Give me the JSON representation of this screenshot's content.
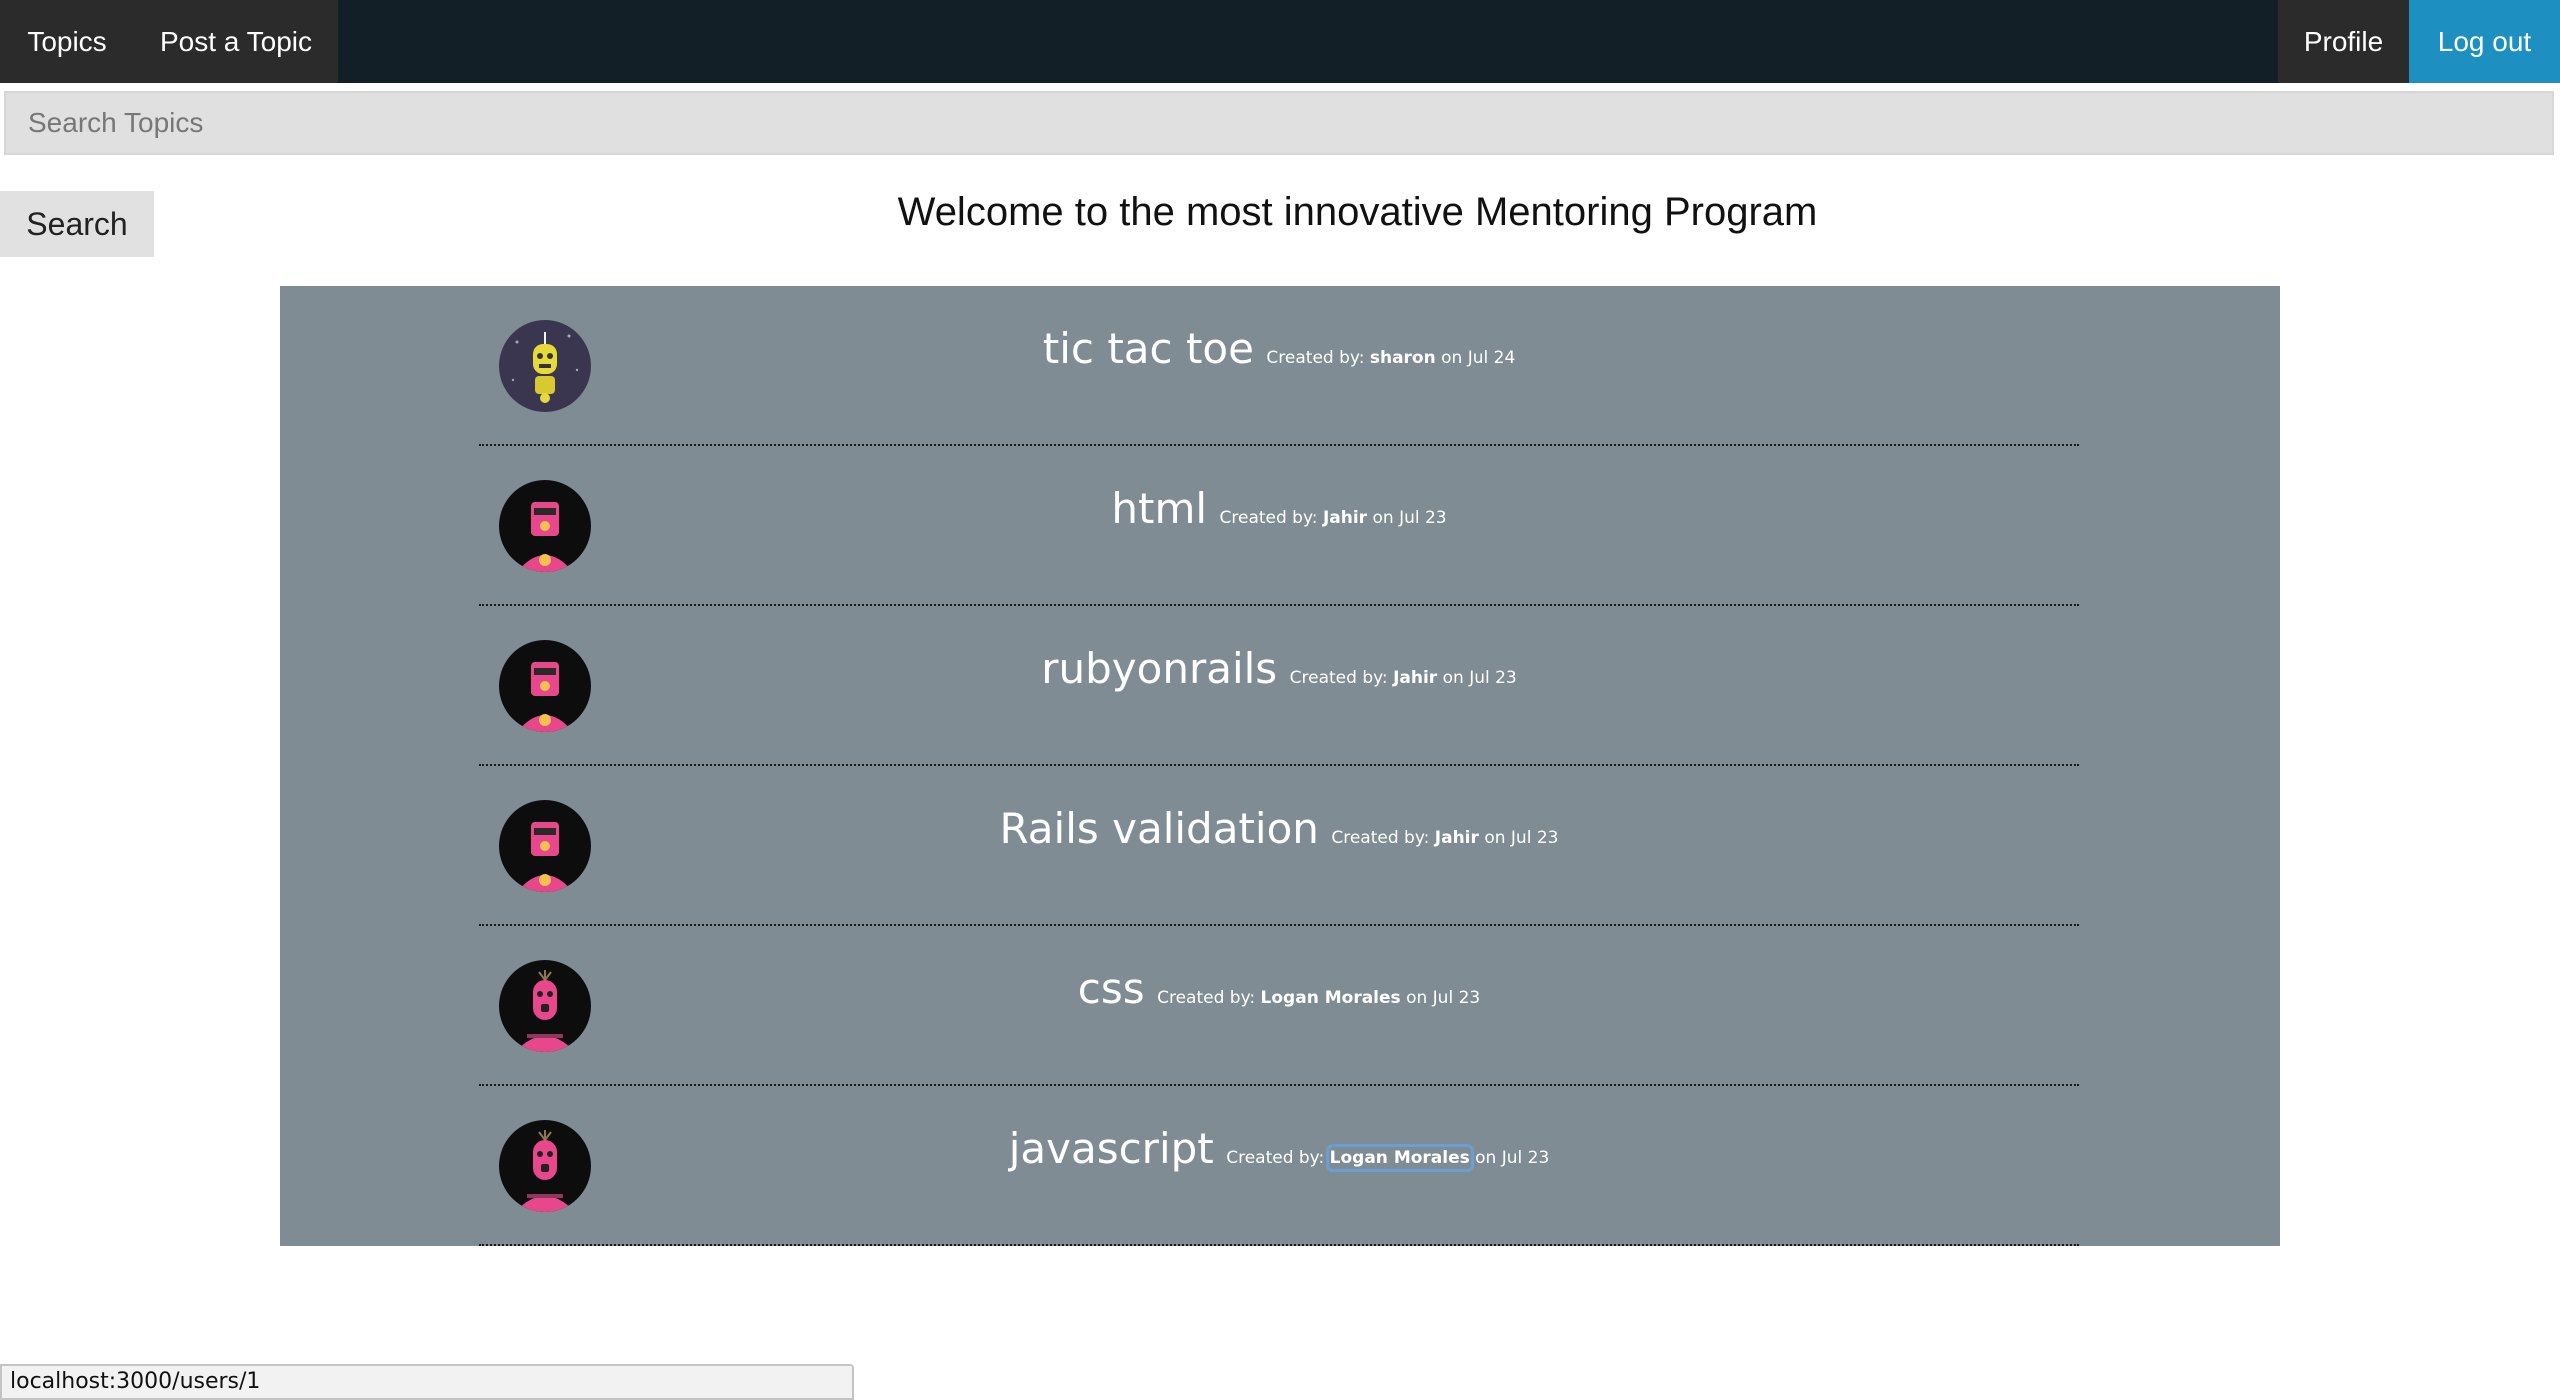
{
  "nav": {
    "topics_label": "Topics",
    "post_label": "Post a Topic",
    "profile_label": "Profile",
    "logout_label": "Log out"
  },
  "search": {
    "placeholder": "Search Topics",
    "button_label": "Search"
  },
  "page": {
    "welcome": "Welcome to the most innovative Mentoring Program"
  },
  "labels": {
    "created_by": "Created by:",
    "on": "on"
  },
  "topics": [
    {
      "title": "tic tac toe",
      "author": "sharon",
      "date": "Jul 24",
      "avatar": "yellow-robot-avatar"
    },
    {
      "title": "html",
      "author": "Jahir",
      "date": "Jul 23",
      "avatar": "pink-robot-avatar"
    },
    {
      "title": "rubyonrails",
      "author": "Jahir",
      "date": "Jul 23",
      "avatar": "pink-robot-avatar"
    },
    {
      "title": "Rails validation",
      "author": "Jahir",
      "date": "Jul 23",
      "avatar": "pink-robot-avatar"
    },
    {
      "title": "css",
      "author": "Logan Morales",
      "date": "Jul 23",
      "avatar": "pink-antenna-robot-avatar"
    },
    {
      "title": "javascript",
      "author": "Logan Morales",
      "date": "Jul 23",
      "avatar": "pink-antenna-robot-avatar"
    }
  ],
  "status_bar": {
    "url": "localhost:3000/users/1"
  },
  "colors": {
    "navbar": "#121f27",
    "nav_button": "#2b2b2b",
    "logout": "#1d8fc1",
    "panel": "#808c93",
    "focus_ring": "#6a9ed6"
  }
}
